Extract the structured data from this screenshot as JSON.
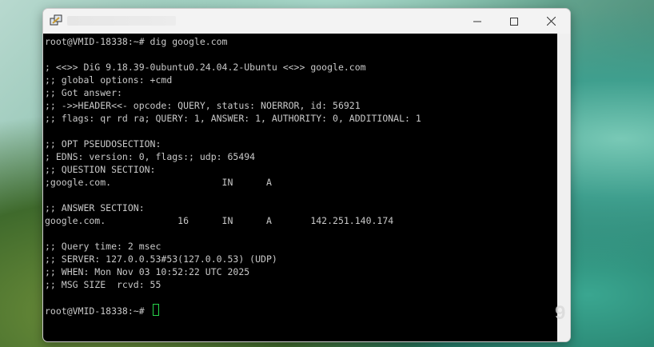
{
  "window": {
    "controls": {
      "minimize_icon": "minimize-icon",
      "maximize_icon": "maximize-icon",
      "close_icon": "close-icon"
    }
  },
  "terminal": {
    "lines": [
      "root@VMID-18338:~# dig google.com",
      "",
      "; <<>> DiG 9.18.39-0ubuntu0.24.04.2-Ubuntu <<>> google.com",
      ";; global options: +cmd",
      ";; Got answer:",
      ";; ->>HEADER<<- opcode: QUERY, status: NOERROR, id: 56921",
      ";; flags: qr rd ra; QUERY: 1, ANSWER: 1, AUTHORITY: 0, ADDITIONAL: 1",
      "",
      ";; OPT PSEUDOSECTION:",
      "; EDNS: version: 0, flags:; udp: 65494",
      ";; QUESTION SECTION:",
      ";google.com.                    IN      A",
      "",
      ";; ANSWER SECTION:",
      "google.com.             16      IN      A       142.251.140.174",
      "",
      ";; Query time: 2 msec",
      ";; SERVER: 127.0.0.53#53(127.0.0.53) (UDP)",
      ";; WHEN: Mon Nov 03 10:52:22 UTC 2025",
      ";; MSG SIZE  rcvd: 55",
      ""
    ],
    "prompt": "root@VMID-18338:~# ",
    "cursor_color": "#27d44a"
  }
}
